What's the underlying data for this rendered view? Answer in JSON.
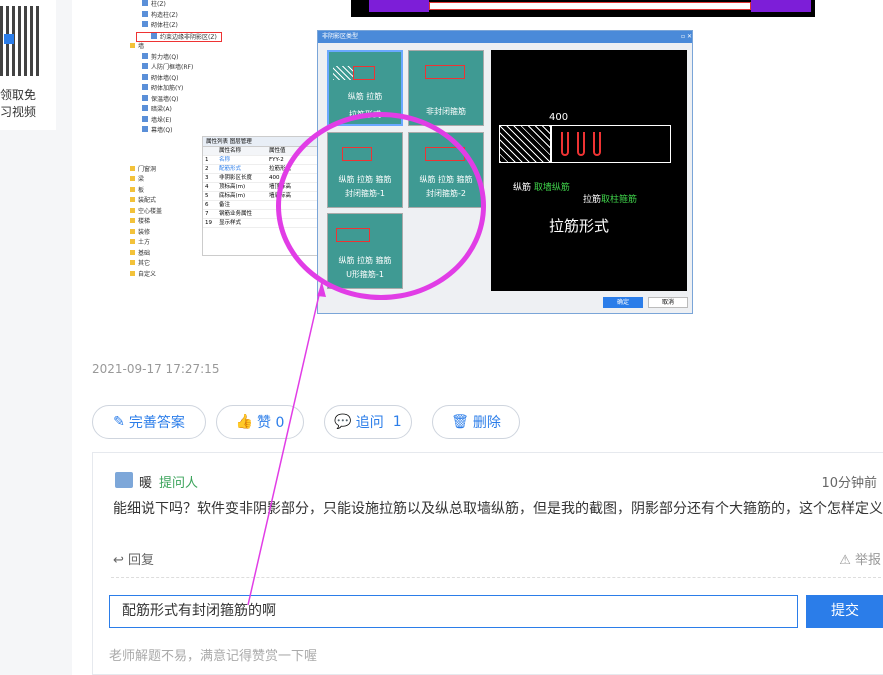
{
  "sidebar": {
    "line1": "领取免",
    "line2": "习视频"
  },
  "screenshot": {
    "tree": [
      "柱(Z)",
      "构造柱(Z)",
      "砌体柱(Z)",
      "约束边缘非阴影区(Z)",
      "墙",
      "剪力墙(Q)",
      "人防门框墙(RF)",
      "砌体墙(Q)",
      "砌体加筋(Y)",
      "保温墙(Q)",
      "暗梁(A)",
      "墙垛(E)",
      "幕墙(Q)",
      "门窗洞",
      "梁",
      "板",
      "装配式",
      "空心楼盖",
      "楼梯",
      "装修",
      "土方",
      "基础",
      "其它",
      "自定义"
    ],
    "prop_tabs": "属性列表  图层管理",
    "prop_rows": [
      [
        "",
        "属性名称",
        "属性值"
      ],
      [
        "1",
        "名称",
        "FYY-2"
      ],
      [
        "2",
        "配筋形式",
        "拉筋形式"
      ],
      [
        "3",
        "非阴影区长度",
        "400"
      ],
      [
        "4",
        "顶标高(m)",
        "墙顶标高"
      ],
      [
        "5",
        "底标高(m)",
        "墙底标高"
      ],
      [
        "6",
        "备注",
        ""
      ],
      [
        "7",
        "钢筋业务属性",
        ""
      ],
      [
        "19",
        "显示样式",
        ""
      ]
    ],
    "dialog_title": "非阴影区类型",
    "tiles": [
      {
        "label": "拉筋形式",
        "sub": "纵筋  拉筋"
      },
      {
        "label": "非封闭箍筋",
        "sub": ""
      },
      {
        "label": "封闭箍筋-1",
        "sub": "纵筋 拉筋 箍筋"
      },
      {
        "label": "封闭箍筋-2",
        "sub": "纵筋 拉筋 箍筋"
      },
      {
        "label": "U形箍筋-1",
        "sub": "纵筋 拉筋 箍筋"
      }
    ],
    "preview": {
      "dim": "400",
      "t1a": "纵筋",
      "t1b": "取墙纵筋",
      "t2a": "拉筋",
      "t2b": "取柱箍筋",
      "big": "拉筋形式"
    },
    "ok": "确定",
    "cancel": "取消"
  },
  "date": "2021-09-17 17:27:15",
  "actions": {
    "complete": "完善答案",
    "like": "赞 0",
    "followup": "追问",
    "followup_count": "1",
    "delete": "删除"
  },
  "reply": {
    "user": "暖",
    "role": "提问人",
    "time": "10分钟前",
    "content": "能细说下吗？软件变非阴影部分，只能设施拉筋以及纵总取墙纵筋，但是我的截图，阴影部分还有个大箍筋的，这个怎样定义",
    "reply_label": "回复",
    "report": "举报"
  },
  "input": {
    "value": "配筋形式有封闭箍筋的啊"
  },
  "submit": "提交",
  "hint": "老师解题不易，满意记得赞赏一下喔",
  "colors": {
    "accent": "#2b7de9",
    "annotation": "#e13de6",
    "tile": "#3f9a93"
  }
}
